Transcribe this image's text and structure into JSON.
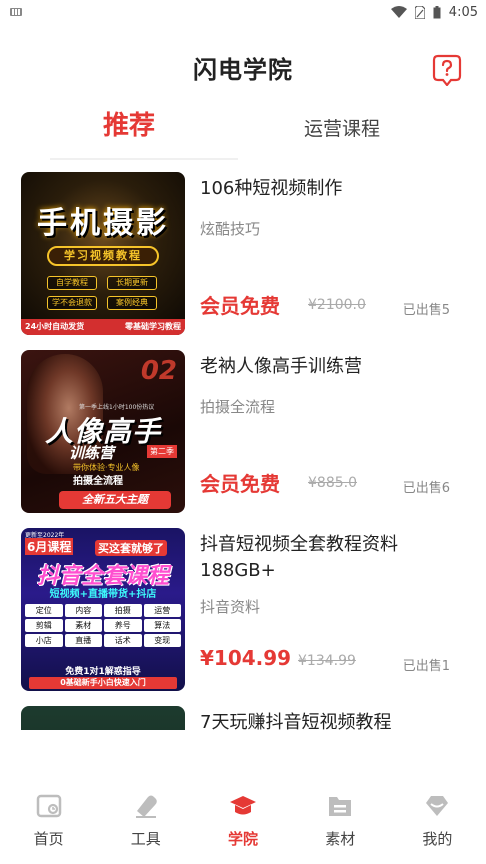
{
  "status_bar": {
    "time": "4:05",
    "icons": [
      "keyboard-icon",
      "wifi-icon",
      "sim-icon",
      "battery-icon"
    ]
  },
  "header": {
    "title": "闪电学院",
    "help_icon": "help-question-icon"
  },
  "tabs": [
    {
      "label": "推荐",
      "active": true
    },
    {
      "label": "运营课程",
      "active": false
    }
  ],
  "courses": [
    {
      "title": "106种短视频制作",
      "subtitle": "炫酷技巧",
      "price": "会员免费",
      "original_price": "¥2100.0",
      "sold": "已出售5",
      "thumb": {
        "headline": "手机摄影",
        "band": "学习视频教程",
        "tags": [
          "自学教程",
          "长期更新",
          "学不会退款",
          "案例经典"
        ],
        "bottom_left": "24小时自动发货",
        "bottom_right": "零基础学习教程"
      }
    },
    {
      "title": "老衲人像高手训练营",
      "subtitle": "拍摄全流程",
      "price": "会员免费",
      "original_price": "¥885.0",
      "sold": "已出售6",
      "thumb": {
        "number": "02",
        "small": "第一季上线1小时100份热议",
        "headline": "人像高手",
        "sub": "训练营",
        "badge": "第二季",
        "line1": "带你体验·专业人像",
        "line2": "拍摄全流程",
        "bottom": "全新五大主题"
      }
    },
    {
      "title": "抖音短视频全套教程资料188GB+",
      "subtitle": "抖音资料",
      "price": "¥104.99",
      "original_price": "¥134.99",
      "sold": "已出售1",
      "thumb": {
        "top": "更新至2022年",
        "month": "6月课程",
        "buy": "买这套就够了",
        "headline": "抖音全套课程",
        "band": "短视频+直播带货+抖店",
        "grid": [
          "定位",
          "内容",
          "拍摄",
          "运营",
          "剪辑",
          "素材",
          "养号",
          "算法",
          "小店",
          "直播",
          "话术",
          "变现"
        ],
        "free": "免费1对1解惑指导",
        "bottom": "0基础新手小白快速入门"
      }
    },
    {
      "title": "7天玩赚抖音短视频教程"
    }
  ],
  "bottom_nav": [
    {
      "label": "首页",
      "icon": "home-icon",
      "active": false
    },
    {
      "label": "工具",
      "icon": "tools-icon",
      "active": false
    },
    {
      "label": "学院",
      "icon": "graduation-cap-icon",
      "active": true
    },
    {
      "label": "素材",
      "icon": "folder-icon",
      "active": false
    },
    {
      "label": "我的",
      "icon": "profile-diamond-icon",
      "active": false
    }
  ],
  "colors": {
    "accent": "#e53935",
    "inactive_icon": "#bdbdbd",
    "text_muted": "#888888"
  }
}
